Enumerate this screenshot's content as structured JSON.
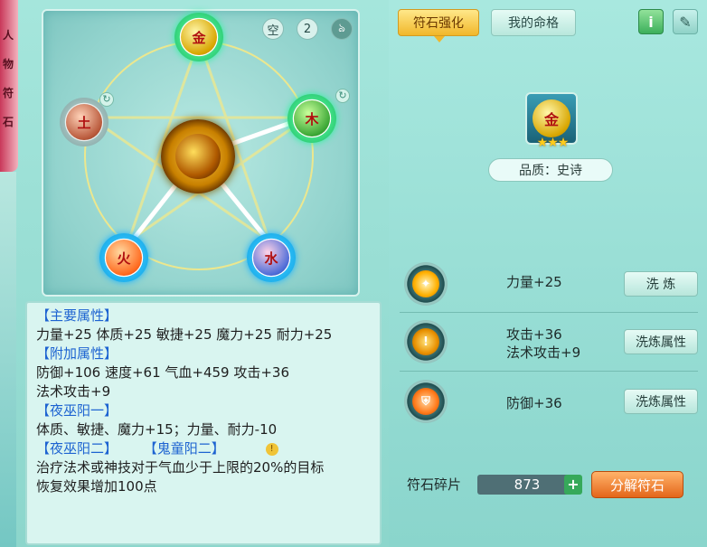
{
  "side_tab": {
    "chars": [
      "人",
      "物",
      "符",
      "石"
    ]
  },
  "board": {
    "badges": [
      "空",
      "2",
      "ঌ"
    ],
    "nodes": {
      "gold": "金",
      "wood": "木",
      "earth": "土",
      "fire": "火",
      "water": "水"
    }
  },
  "stats": {
    "main_header": "【主要属性】",
    "main_values": "力量+25  体质+25  敏捷+25  魔力+25  耐力+25",
    "extra_header": "【附加属性】",
    "extra_line1": "防御+106  速度+61  气血+459  攻击+36",
    "extra_line2": "法术攻击+9",
    "set1_header": "【夜巫阳一】",
    "set1_text": "体质、敏捷、魔力+15；力量、耐力-10",
    "set2_header": "【夜巫阳二】",
    "set3_header": "【鬼童阳二】",
    "set2_text_line1": "治疗法术或神技对于气血少于上限的20%的目标",
    "set2_text_line2": "恢复效果增加100点"
  },
  "right": {
    "tab_enhance": "符石强化",
    "tab_fate": "我的命格",
    "info_label": "i",
    "rune_char": "金",
    "stars": "★★★",
    "quality": "品质：史诗",
    "attrs": [
      {
        "text": "力量+25",
        "button": "洗 炼"
      },
      {
        "text": "攻击+36",
        "text2": "法术攻击+9",
        "button": "洗炼属性"
      },
      {
        "text": "防御+36",
        "button": "洗炼属性"
      }
    ],
    "fragment_label": "符石碎片",
    "fragment_count": "873",
    "add_label": "+",
    "decompose_label": "分解符石"
  }
}
